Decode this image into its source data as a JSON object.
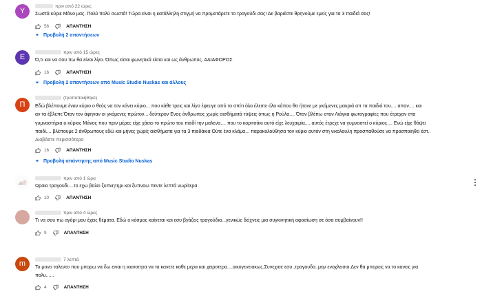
{
  "comments": [
    {
      "avatar_letter": "Y",
      "avatar_color": "#ab47bc",
      "time": "πριν από 22 ώρες",
      "lines": [
        "Σωστά κύριε Μάνο μας. Πολύ πολύ σωστά! Τώρα είναι η κατάλληλη στιγμή να προμοτάρετε το τραγούδι σας! Δε βαριέστε θρηνούμε εμείς για τα 3 παιδιά σας!"
      ],
      "likes": "56",
      "reply_label": "ΑΠΑΝΤΗΣΗ",
      "replies_label": "Προβολή 2 απαντήσεων"
    },
    {
      "avatar_letter": "Ε",
      "avatar_color": "#5e35b1",
      "time": "πριν από 15 ώρες",
      "lines": [
        "Ό,τι και να σου πω θα είναι λίγο. Όπως είσαι φωνητικά είσαι και ως άνθρωπος. ΑΔΙΑΦΟΡΟΣ"
      ],
      "likes": "16",
      "reply_label": "ΑΠΑΝΤΗΣΗ",
      "replies_label": "Προβολή 2 απαντήσεων από Music Studio Nuskas και άλλους"
    },
    {
      "avatar_letter": "Π",
      "avatar_color": "#d84315",
      "time": "(τροποποιήθηκε)",
      "lines": [
        "Εδώ  βλέπουμε έναν κύριο ο θεός να τον κάνει κύριο... που κάθε τρεις και λίγο έφευγε από το σπίτι όλο έλειπε όλο κάπου θα ήτανε με γκόμενες μακριά απ τα παιδιά του.... απαν.... και",
        "αν τα έβλεπε Όταν τον άφηναν οι γκόμενες πρώτον... δεύτερον Ενας άνθρωπος χωρίς αισθήματά τύψεις όπως η Ρούλα.... Όταν βλέπω στον Λιάγκα φωτογραφίες που έτρεχαν στα",
        "γυμναστήρια ο κύριος Μάνος που πριν μέρες είχε χάσει το πρώτο του παιδί την μαλενα.... που το κοριτσάκι αυτό είχε λευχαιμία.... αυτός έτρεχε να γυμναστεί ο κύριος.... Ενώ είχε θάψει",
        "παιδί.... βλέπουμε 2 άνθρωπους εδώ και μήνες χωρίς αισθήματα για τα 3 παιδάκια Ούτε ένα κλάμα... παρακολούθησα τον κύριο αυτόν στη νικολουλη προσπαθούσε να προσποιηθεί έστ.."
      ],
      "read_more": "Διαβάστε περισσότερα",
      "likes": "16",
      "reply_label": "ΑΠΑΝΤΗΣΗ",
      "replies_label": "Προβολή απάντησης από Music Studio Nuskas"
    },
    {
      "time": "πριν από 1 ώρα",
      "lines": [
        "Ωραιο τραγουδι....το εχω βαλει ξυπνητηρι και ξυπναω πεντε λεπτά νωρίτερα"
      ],
      "likes": "10",
      "reply_label": "ΑΠΑΝΤΗΣΗ"
    },
    {
      "avatar_color": "#d7a89f",
      "time": "πριν από 4 ώρες",
      "lines": [
        "Τι να σου πω αγόρι μου έχεις θέματα. Εδώ ο κόσμος καίγεται και εσυ βγάζεις τραγούδια...γενικώς δείχνεις μια συγκινητική αφοσίωση σε όσα συμβαίνουν!!"
      ],
      "likes": "9",
      "reply_label": "ΑΠΑΝΤΗΣΗ"
    },
    {
      "avatar_letter": "m",
      "avatar_color": "#c8480d",
      "time": "7 λεπτά",
      "lines": [
        "Το μονο ταλεντο που μπορω να δω ειναι η ικανοτητα να τα κανετε καθε μερα και χειροτερα....οικογενειακως.Συνεχισε εσυ ,τραγουδα..μην ενοχλεισαι.Δεν θα μπορεις να το κανεις για",
        "πολυ......"
      ],
      "likes": "4",
      "reply_label": "ΑΠΑΝΤΗΣΗ"
    }
  ]
}
